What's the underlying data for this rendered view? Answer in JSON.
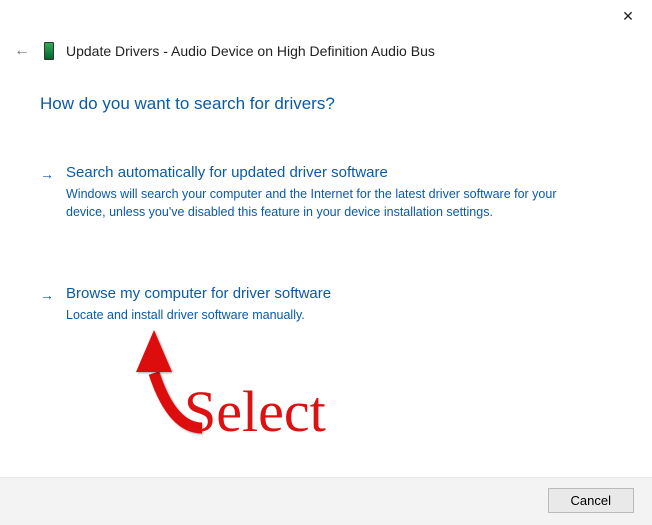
{
  "window": {
    "title": "Update Drivers - Audio Device on High Definition Audio Bus"
  },
  "heading": "How do you want to search for drivers?",
  "options": [
    {
      "title": "Search automatically for updated driver software",
      "description": "Windows will search your computer and the Internet for the latest driver software for your device, unless you've disabled this feature in your device installation settings."
    },
    {
      "title": "Browse my computer for driver software",
      "description": "Locate and install driver software manually."
    }
  ],
  "footer": {
    "cancel_label": "Cancel"
  },
  "annotation": {
    "label": "Select"
  }
}
